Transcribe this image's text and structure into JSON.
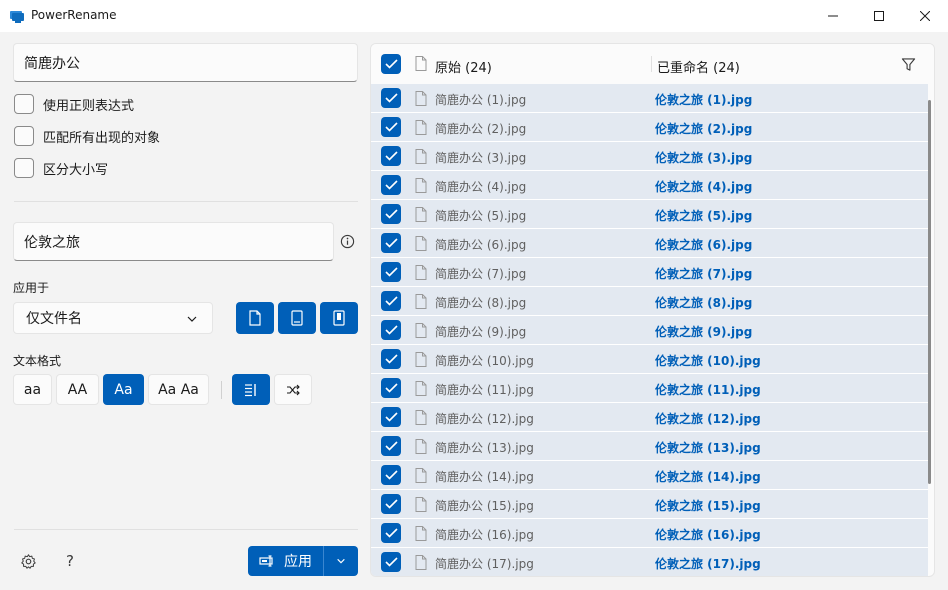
{
  "window": {
    "title": "PowerRename"
  },
  "search": {
    "value": "简鹿办公"
  },
  "options": {
    "use_regex": "使用正则表达式",
    "match_all": "匹配所有出现的对象",
    "case_sensitive": "区分大小写"
  },
  "replace": {
    "value": "伦敦之旅"
  },
  "apply_to": {
    "label": "应用于",
    "selected": "仅文件名"
  },
  "text_format": {
    "label": "文本格式",
    "lowercase": "aa",
    "uppercase": "AA",
    "titlecase": "Aa",
    "capitalize": "Aa Aa"
  },
  "footer": {
    "help": "?",
    "apply_label": "应用"
  },
  "list": {
    "original_header": "原始 (24)",
    "renamed_header": "已重命名 (24)",
    "rows": [
      {
        "original": "简鹿办公 (1).jpg",
        "renamed": "伦敦之旅 (1).jpg"
      },
      {
        "original": "简鹿办公 (2).jpg",
        "renamed": "伦敦之旅 (2).jpg"
      },
      {
        "original": "简鹿办公 (3).jpg",
        "renamed": "伦敦之旅 (3).jpg"
      },
      {
        "original": "简鹿办公 (4).jpg",
        "renamed": "伦敦之旅 (4).jpg"
      },
      {
        "original": "简鹿办公 (5).jpg",
        "renamed": "伦敦之旅 (5).jpg"
      },
      {
        "original": "简鹿办公 (6).jpg",
        "renamed": "伦敦之旅 (6).jpg"
      },
      {
        "original": "简鹿办公 (7).jpg",
        "renamed": "伦敦之旅 (7).jpg"
      },
      {
        "original": "简鹿办公 (8).jpg",
        "renamed": "伦敦之旅 (8).jpg"
      },
      {
        "original": "简鹿办公 (9).jpg",
        "renamed": "伦敦之旅 (9).jpg"
      },
      {
        "original": "简鹿办公 (10).jpg",
        "renamed": "伦敦之旅 (10).jpg"
      },
      {
        "original": "简鹿办公 (11).jpg",
        "renamed": "伦敦之旅 (11).jpg"
      },
      {
        "original": "简鹿办公 (12).jpg",
        "renamed": "伦敦之旅 (12).jpg"
      },
      {
        "original": "简鹿办公 (13).jpg",
        "renamed": "伦敦之旅 (13).jpg"
      },
      {
        "original": "简鹿办公 (14).jpg",
        "renamed": "伦敦之旅 (14).jpg"
      },
      {
        "original": "简鹿办公 (15).jpg",
        "renamed": "伦敦之旅 (15).jpg"
      },
      {
        "original": "简鹿办公 (16).jpg",
        "renamed": "伦敦之旅 (16).jpg"
      },
      {
        "original": "简鹿办公 (17).jpg",
        "renamed": "伦敦之旅 (17).jpg"
      }
    ]
  },
  "colors": {
    "accent": "#005fb8",
    "row_bg": "#e3e9f1",
    "window_bg": "#f3f3f3"
  },
  "icons": [
    "app-icon",
    "minimize-icon",
    "maximize-icon",
    "close-icon",
    "info-icon",
    "chevron-down-icon",
    "file-icon",
    "filter-icon",
    "settings-icon",
    "rename-icon",
    "shuffle-icon",
    "enumerate-icon"
  ]
}
